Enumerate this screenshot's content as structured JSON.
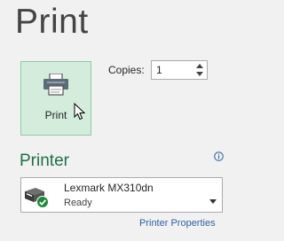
{
  "page": {
    "title": "Print"
  },
  "print_button": {
    "label": "Print",
    "icon": "printer-icon"
  },
  "copies": {
    "label": "Copies:",
    "value": "1"
  },
  "printer_section": {
    "title": "Printer",
    "info_icon": "info-icon",
    "selected_printer": {
      "name": "Lexmark MX310dn",
      "status": "Ready",
      "icon": "network-printer-ready-icon"
    },
    "properties_link": "Printer Properties"
  },
  "colors": {
    "accent_green": "#1e7145",
    "print_button_bg": "#d3ecdc",
    "link_blue": "#2e5fa6",
    "background": "#f1f1f1"
  }
}
